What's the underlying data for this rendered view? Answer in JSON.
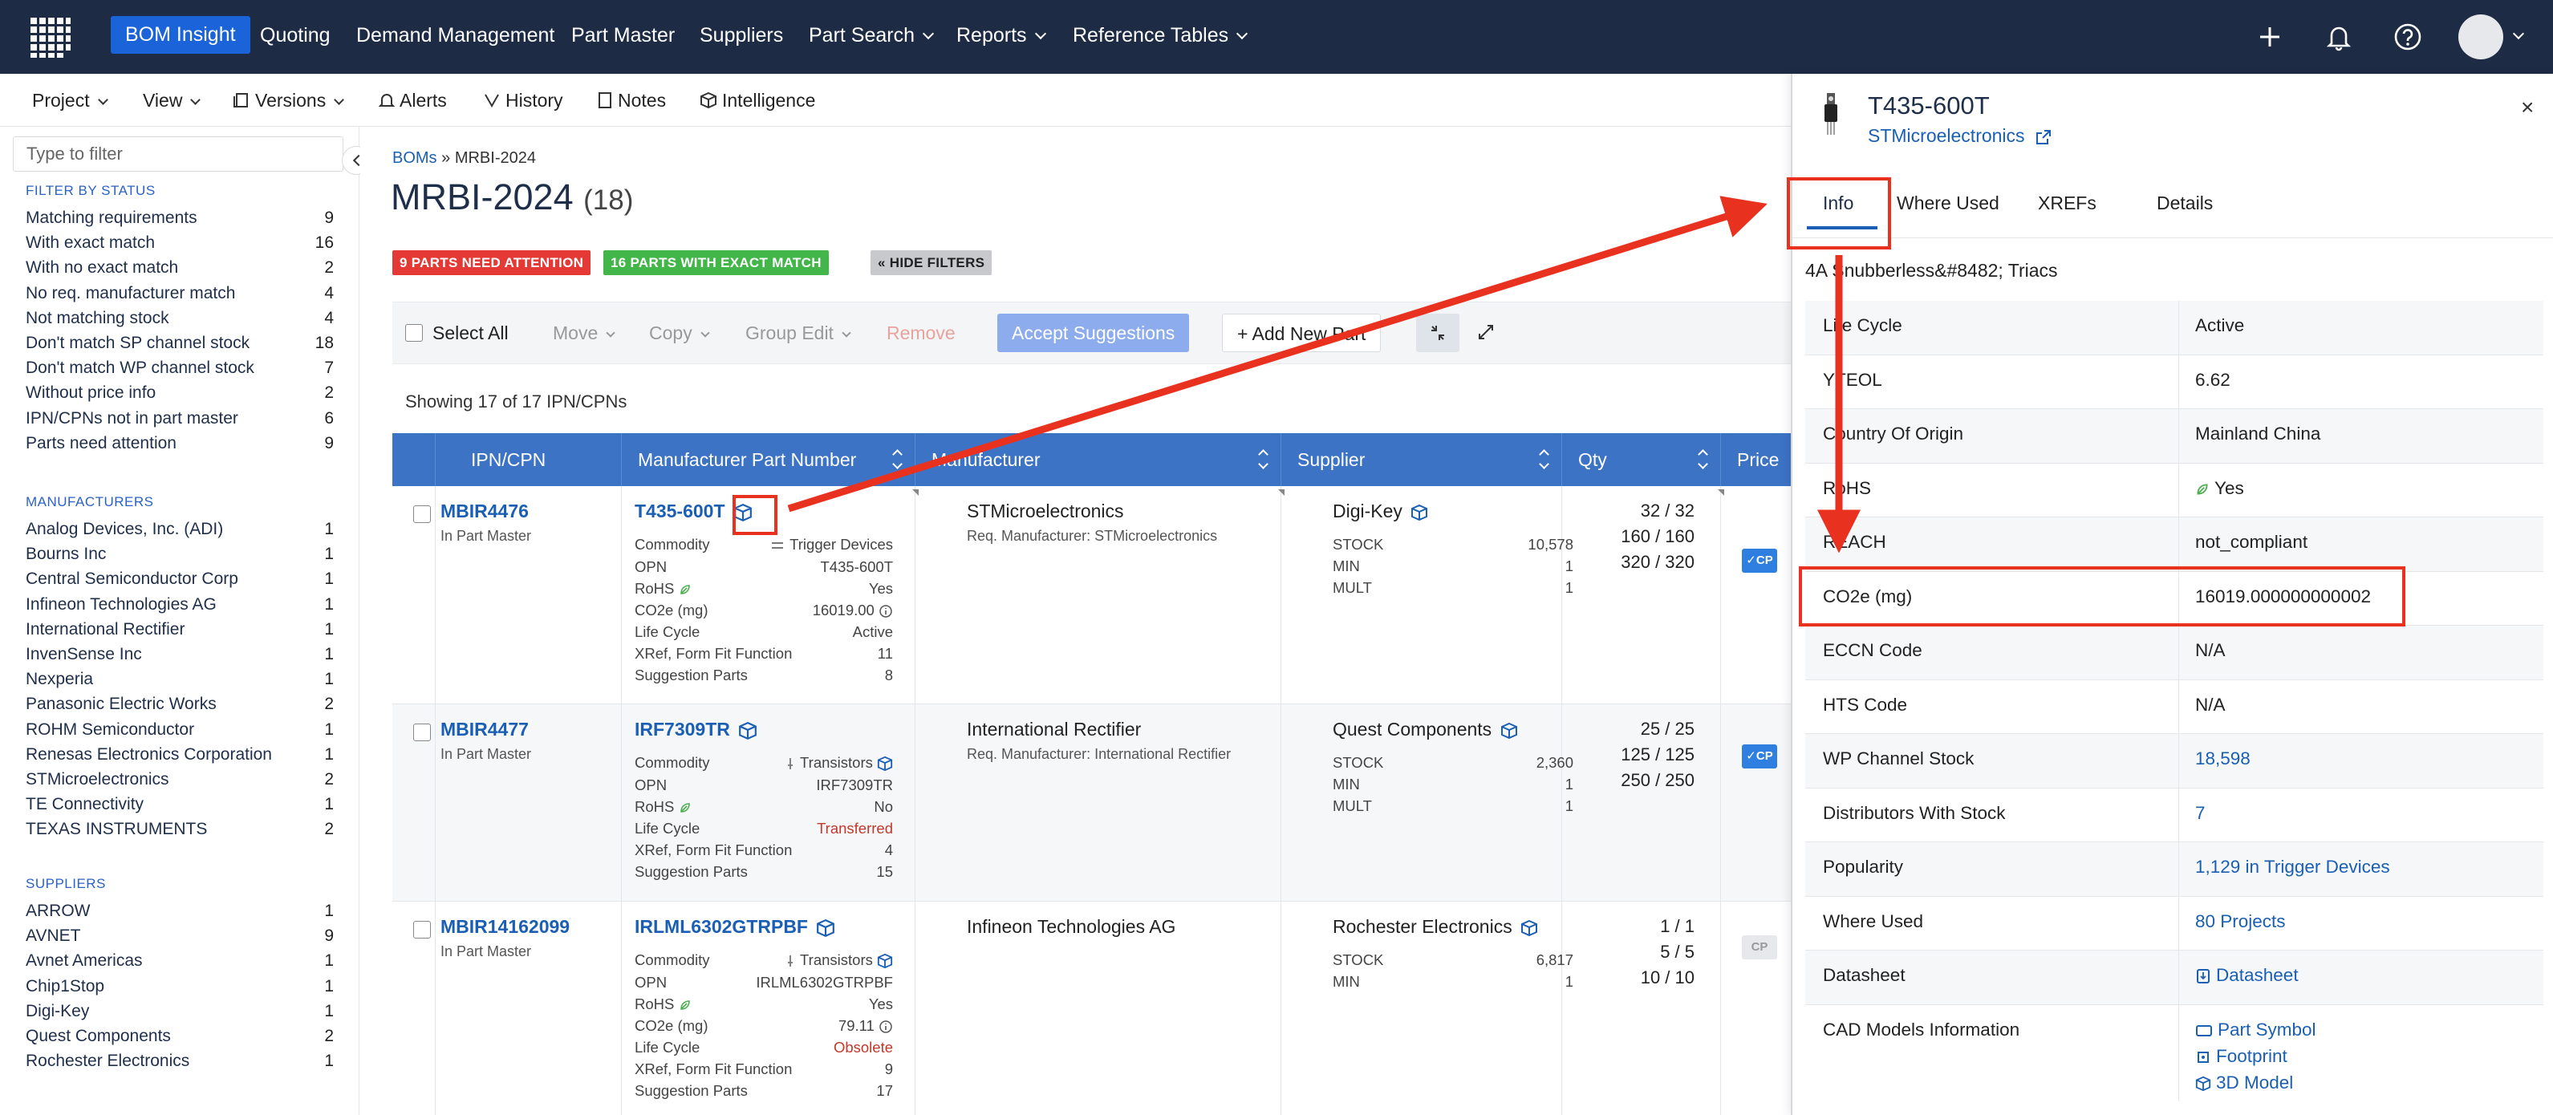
{
  "topnav": {
    "items": [
      "BOM Insight",
      "Quoting",
      "Demand Management",
      "Part Master",
      "Suppliers",
      "Part Search",
      "Reports",
      "Reference Tables"
    ]
  },
  "toolbar": {
    "project": "Project",
    "view": "View",
    "versions": "Versions",
    "alerts": "Alerts",
    "history": "History",
    "notes": "Notes",
    "intelligence": "Intelligence"
  },
  "filter": {
    "placeholder": "Type to filter",
    "status_heading": "FILTER BY STATUS",
    "status": [
      {
        "label": "Matching requirements",
        "count": "9"
      },
      {
        "label": "With exact match",
        "count": "16"
      },
      {
        "label": "With no exact match",
        "count": "2"
      },
      {
        "label": "No req. manufacturer match",
        "count": "4"
      },
      {
        "label": "Not matching stock",
        "count": "4"
      },
      {
        "label": "Don't match SP channel stock",
        "count": "18"
      },
      {
        "label": "Don't match WP channel stock",
        "count": "7"
      },
      {
        "label": "Without price info",
        "count": "2"
      },
      {
        "label": "IPN/CPNs not in part master",
        "count": "6"
      },
      {
        "label": "Parts need attention",
        "count": "9"
      }
    ],
    "manufacturers_heading": "MANUFACTURERS",
    "manufacturers": [
      {
        "label": "Analog Devices, Inc. (ADI)",
        "count": "1"
      },
      {
        "label": "Bourns Inc",
        "count": "1"
      },
      {
        "label": "Central Semiconductor Corp",
        "count": "1"
      },
      {
        "label": "Infineon Technologies AG",
        "count": "1"
      },
      {
        "label": "International Rectifier",
        "count": "1"
      },
      {
        "label": "InvenSense Inc",
        "count": "1"
      },
      {
        "label": "Nexperia",
        "count": "1"
      },
      {
        "label": "Panasonic Electric Works",
        "count": "2"
      },
      {
        "label": "ROHM Semiconductor",
        "count": "1"
      },
      {
        "label": "Renesas Electronics Corporation",
        "count": "1"
      },
      {
        "label": "STMicroelectronics",
        "count": "2"
      },
      {
        "label": "TE Connectivity",
        "count": "1"
      },
      {
        "label": "TEXAS INSTRUMENTS",
        "count": "2"
      }
    ],
    "suppliers_heading": "SUPPLIERS",
    "suppliers": [
      {
        "label": "ARROW",
        "count": "1"
      },
      {
        "label": "AVNET",
        "count": "9"
      },
      {
        "label": "Avnet Americas",
        "count": "1"
      },
      {
        "label": "Chip1Stop",
        "count": "1"
      },
      {
        "label": "Digi-Key",
        "count": "1"
      },
      {
        "label": "Quest Components",
        "count": "2"
      },
      {
        "label": "Rochester Electronics",
        "count": "1"
      }
    ]
  },
  "main": {
    "breadcrumb_link": "BOMs",
    "breadcrumb_sep": "»",
    "breadcrumb_current": "MRBI-2024",
    "title": "MRBI-2024",
    "title_count": "(18)",
    "tags": {
      "attention": "9 PARTS NEED ATTENTION",
      "exact": "16 PARTS WITH EXACT MATCH",
      "hide": "« HIDE FILTERS"
    },
    "actions": {
      "select_all": "Select All",
      "move": "Move",
      "copy": "Copy",
      "group_edit": "Group Edit",
      "remove": "Remove",
      "accept": "Accept Suggestions",
      "add_new": "+ Add New Part"
    },
    "showing": "Showing 17 of 17 IPN/CPNs",
    "columns": [
      "IPN/CPN",
      "Manufacturer Part Number",
      "Manufacturer",
      "Supplier",
      "Qty",
      "Price"
    ],
    "rows": [
      {
        "ipn": "MBIR4476",
        "ipn_sub": "In Part Master",
        "mpn": "T435-600T",
        "commodity": "Trigger Devices",
        "opn": "T435-600T",
        "rohs": "Yes",
        "co2": "16019.00",
        "lifecycle": "Active",
        "xref": "11",
        "suggestions": "8",
        "manufacturer": "STMicroelectronics",
        "req_mfr": "Req. Manufacturer: STMicroelectronics",
        "supplier": "Digi-Key",
        "stock": "10,578",
        "min": "1",
        "mult": "1",
        "qty": [
          "32 / 32",
          "160 / 160",
          "320 / 320"
        ],
        "cp": "✓CP"
      },
      {
        "ipn": "MBIR4477",
        "ipn_sub": "In Part Master",
        "mpn": "IRF7309TR",
        "commodity": "Transistors",
        "opn": "IRF7309TR",
        "rohs": "No",
        "lifecycle": "Transferred",
        "xref": "4",
        "suggestions": "15",
        "manufacturer": "International Rectifier",
        "req_mfr": "Req. Manufacturer: International Rectifier",
        "supplier": "Quest Components",
        "stock": "2,360",
        "min": "1",
        "mult": "1",
        "qty": [
          "25 / 25",
          "125 / 125",
          "250 / 250"
        ],
        "cp": "✓CP"
      },
      {
        "ipn": "MBIR14162099",
        "ipn_sub": "In Part Master",
        "mpn": "IRLML6302GTRPBF",
        "commodity": "Transistors",
        "opn": "IRLML6302GTRPBF",
        "rohs": "Yes",
        "co2": "79.11",
        "lifecycle": "Obsolete",
        "xref": "9",
        "suggestions": "17",
        "manufacturer": "Infineon Technologies AG",
        "supplier": "Rochester Electronics",
        "stock": "6,817",
        "min": "1",
        "qty": [
          "1 / 1",
          "5 / 5",
          "10 / 10"
        ],
        "cp": "CP"
      }
    ],
    "kv_labels": {
      "commodity": "Commodity",
      "opn": "OPN",
      "rohs": "RoHS",
      "co2": "CO2e (mg)",
      "lifecycle": "Life Cycle",
      "xref": "XRef, Form Fit Function",
      "suggestions": "Suggestion Parts",
      "stock": "STOCK",
      "min": "MIN",
      "mult": "MULT"
    }
  },
  "drawer": {
    "title": "T435-600T",
    "manufacturer": "STMicroelectronics",
    "tabs": [
      "Info",
      "Where Used",
      "XREFs",
      "Details"
    ],
    "description": "4A Snubberless&#8482; Triacs",
    "rows": [
      {
        "k": "Life Cycle",
        "v": "Active"
      },
      {
        "k": "YTEOL",
        "v": "6.62"
      },
      {
        "k": "Country Of Origin",
        "v": "Mainland China"
      },
      {
        "k": "RoHS",
        "v": "Yes"
      },
      {
        "k": "REACH",
        "v": "not_compliant"
      },
      {
        "k": "CO2e (mg)",
        "v": "16019.000000000002"
      },
      {
        "k": "ECCN Code",
        "v": "N/A"
      },
      {
        "k": "HTS Code",
        "v": "N/A"
      },
      {
        "k": "WP Channel Stock",
        "v": "18,598"
      },
      {
        "k": "Distributors With Stock",
        "v": "7"
      },
      {
        "k": "Popularity",
        "v": "1,129 in Trigger Devices"
      },
      {
        "k": "Where Used",
        "v": "80 Projects"
      },
      {
        "k": "Datasheet",
        "v": "Datasheet"
      },
      {
        "k": "CAD Models Information",
        "v": "Part Symbol",
        "v2": "Footprint",
        "v3": "3D Model"
      }
    ]
  },
  "colors": {
    "nav_bg": "#1d2b45",
    "accent": "#1a63d8",
    "header_bg": "#3d73c5",
    "attention": "#e53935",
    "exact": "#43b649",
    "annotation": "#e8321f"
  }
}
